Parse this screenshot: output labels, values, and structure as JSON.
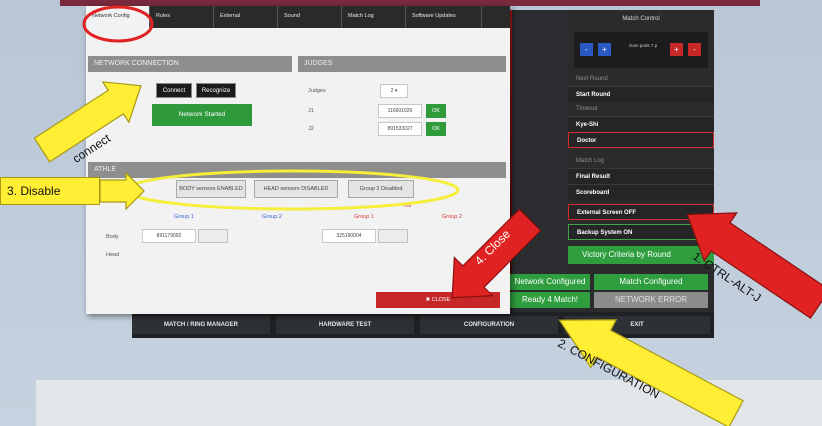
{
  "back_window": {
    "match_control_title": "Match Control",
    "game_point_label": "Gam point 7 p",
    "side_headers": [
      "Next Round",
      "Timeout",
      "Match Log"
    ],
    "side_buttons": [
      "Start Round",
      "Kye-Shi",
      "Doctor",
      "Final Result",
      "Scoreboard",
      "External Screen  OFF",
      "Backup System  ON"
    ],
    "victory_label": "Victory Criteria by Round",
    "score_digit": "0",
    "status": {
      "network_configured": "Network Configured",
      "match_configured": "Match Configured",
      "ready": "Ready 4 Match!",
      "network_error": "NETWORK ERROR"
    },
    "nav": {
      "match_ring_manager": "MATCH / RING MANAGER",
      "hardware_test": "HARDWARE TEST",
      "configuration": "CONFIGURATION",
      "exit": "EXIT"
    }
  },
  "dialog": {
    "tabs": [
      "Network Config",
      "Rules",
      "External",
      "Sound",
      "Match Log",
      "Software Updates"
    ],
    "network_connection_title": "NETWORK CONNECTION",
    "connect_label": "Connect",
    "recognize_label": "Recognize",
    "network_started_label": "Network Started",
    "judges_title": "JUDGES",
    "judges_label": "Judges",
    "judges_count": "2",
    "j1_label": "J1",
    "j1_value": "116601026",
    "j2_label": "J2",
    "j2_value": "891533027",
    "ok_label": "OK",
    "athletes_title": "ATHLE",
    "body_sensors": "BODY sensors ENABLED",
    "head_sensors": "HEAD sensors DISABLED",
    "group2_disabled": "Group 2 Disabled",
    "red_small": "Red",
    "groups": [
      "Group 1",
      "Group 2",
      "Group 1",
      "Group 2"
    ],
    "body_label": "Body",
    "head_label": "Head",
    "body_blue_value": "891179092",
    "body_red_value": "325190004",
    "close_label": "CLOSE"
  },
  "annotations": {
    "connect": "connect",
    "disable": "3. Disable",
    "close": "4. Close",
    "ctrl_alt_j": "1. CTRL-ALT-J",
    "configuration": "2. CONFIGURATION"
  },
  "colors": {
    "annotation_red": "#e02222",
    "annotation_yellow": "#ffee33",
    "ellipse_yellow": "#f5ee3a"
  }
}
